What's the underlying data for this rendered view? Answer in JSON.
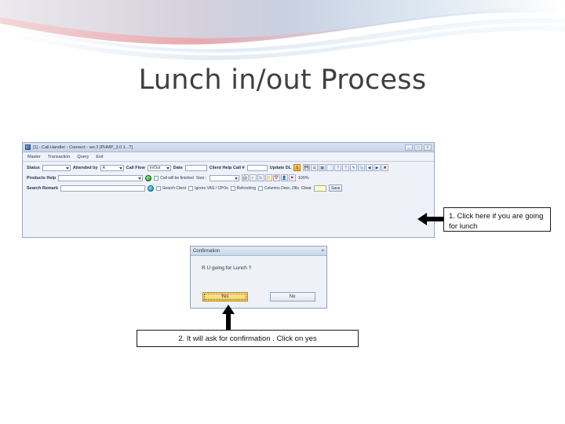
{
  "slide": {
    "title": "Lunch in/out Process"
  },
  "app_window": {
    "titlebar": {
      "text": "[1] - Call Handler - Connect - ver.2 [PHMP_3.0.1...?]",
      "minimize": "_",
      "maximize": "□",
      "close": "×"
    },
    "menu": [
      "Master",
      "Transaction",
      "Query",
      "Exit"
    ],
    "row1": {
      "labels": [
        "Status",
        "Attended by",
        "Call Flow",
        "Date",
        "Client Help Call #",
        "Update DL"
      ],
      "status_value": "",
      "attended_value": "A",
      "callflow_value": "In/Out",
      "date_value": "",
      "helpcall_value": "",
      "update_button": "5"
    },
    "row2": {
      "label_left": "Products Help",
      "field_value": "",
      "checkbox": "Call will be finished",
      "size_label": "Size :",
      "percent": "100%"
    },
    "row3": {
      "label_left": "Search Remark",
      "search_client": "Search Client",
      "ignore_vas_cpos": "Ignore VAS / CPOs",
      "refresh_grid": "Refreshing",
      "columns_desc_dtls": "Columns Desc. Dtls",
      "clear_label": "Clear",
      "save_label": "Save"
    }
  },
  "confirm_dialog": {
    "title": "Confirmation",
    "close": "×",
    "message": "R U going for Lunch ?",
    "yes_label": "Yes",
    "no_label": "No"
  },
  "callouts": [
    {
      "id": "callout-1",
      "text": "1. Click here if you are going for lunch"
    },
    {
      "id": "callout-2",
      "text": "2. It will ask for confirmation . Click on yes"
    }
  ],
  "colors": {
    "deco_pink": "#e7a9ae",
    "deco_blue": "#bcd3e6",
    "title_color": "#3f3f3f",
    "highlight_yellow": "#ffffc0",
    "arrow_black": "#000000"
  }
}
